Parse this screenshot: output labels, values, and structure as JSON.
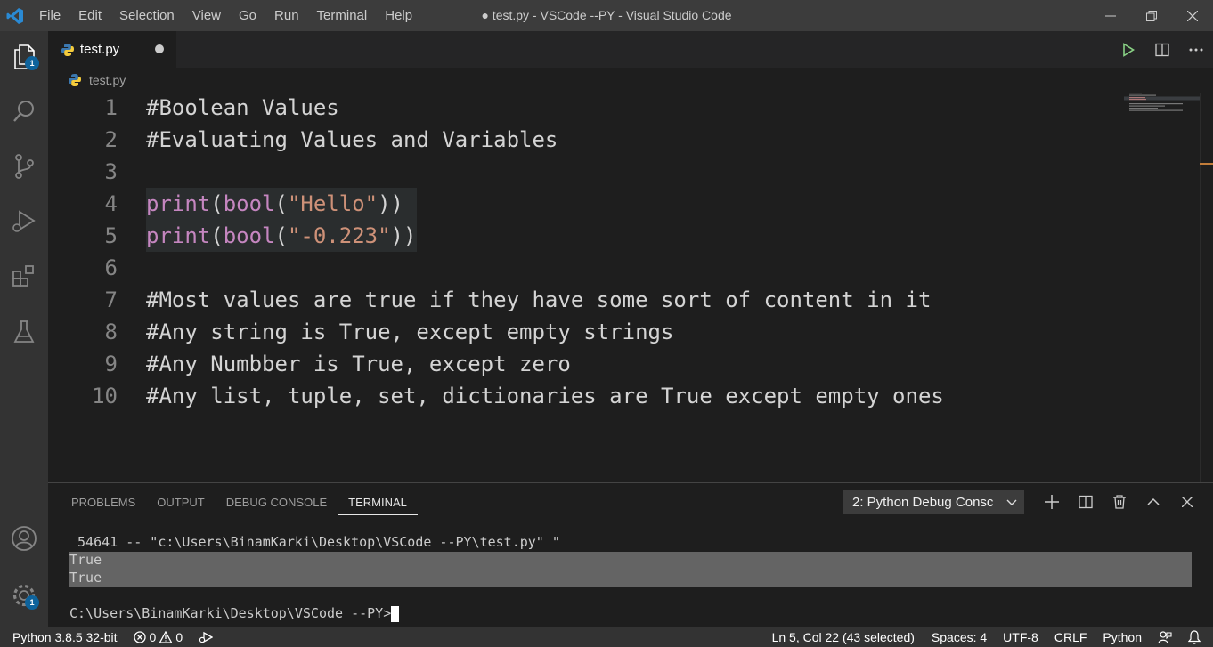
{
  "titlebar": {
    "menu": [
      "File",
      "Edit",
      "Selection",
      "View",
      "Go",
      "Run",
      "Terminal",
      "Help"
    ],
    "title": "● test.py - VSCode --PY - Visual Studio Code"
  },
  "activity": {
    "explorer_badge": "1",
    "settings_badge": "1"
  },
  "tab": {
    "label": "test.py"
  },
  "breadcrumb": {
    "file": "test.py"
  },
  "editor": {
    "lines": [
      {
        "n": "1",
        "text": "#Boolean Values"
      },
      {
        "n": "2",
        "text": "#Evaluating Values and Variables"
      },
      {
        "n": "3",
        "text": ""
      },
      {
        "n": "4",
        "fn": "print",
        "inner": "bool",
        "str": "\"Hello\"",
        "close": "))"
      },
      {
        "n": "5",
        "fn": "print",
        "inner": "bool",
        "str": "\"-0.223\"",
        "close": "))"
      },
      {
        "n": "6",
        "text": ""
      },
      {
        "n": "7",
        "text": "#Most values are true if they have some sort of content in it"
      },
      {
        "n": "8",
        "text": "#Any string is True, except empty strings"
      },
      {
        "n": "9",
        "text": "#Any Numbber is True, except zero"
      },
      {
        "n": "10",
        "text": "#Any list, tuple, set, dictionaries are True except empty ones"
      }
    ]
  },
  "panel": {
    "tabs": [
      "PROBLEMS",
      "OUTPUT",
      "DEBUG CONSOLE",
      "TERMINAL"
    ],
    "terminal_select": "2: Python Debug Consc",
    "terminal_lines": [
      " 54641 -- \"c:\\Users\\BinamKarki\\Desktop\\VSCode --PY\\test.py\" \"",
      "True",
      "True",
      "",
      "C:\\Users\\BinamKarki\\Desktop\\VSCode --PY>"
    ]
  },
  "statusbar": {
    "interpreter": "Python 3.8.5 32-bit",
    "errors": "0",
    "warnings": "0",
    "cursor": "Ln 5, Col 22 (43 selected)",
    "spaces": "Spaces: 4",
    "encoding": "UTF-8",
    "eol": "CRLF",
    "language": "Python"
  },
  "colors": {
    "accent": "#0e639c",
    "comment": "#d4d4d4",
    "keyword": "#c586c0",
    "string": "#ce9178"
  }
}
